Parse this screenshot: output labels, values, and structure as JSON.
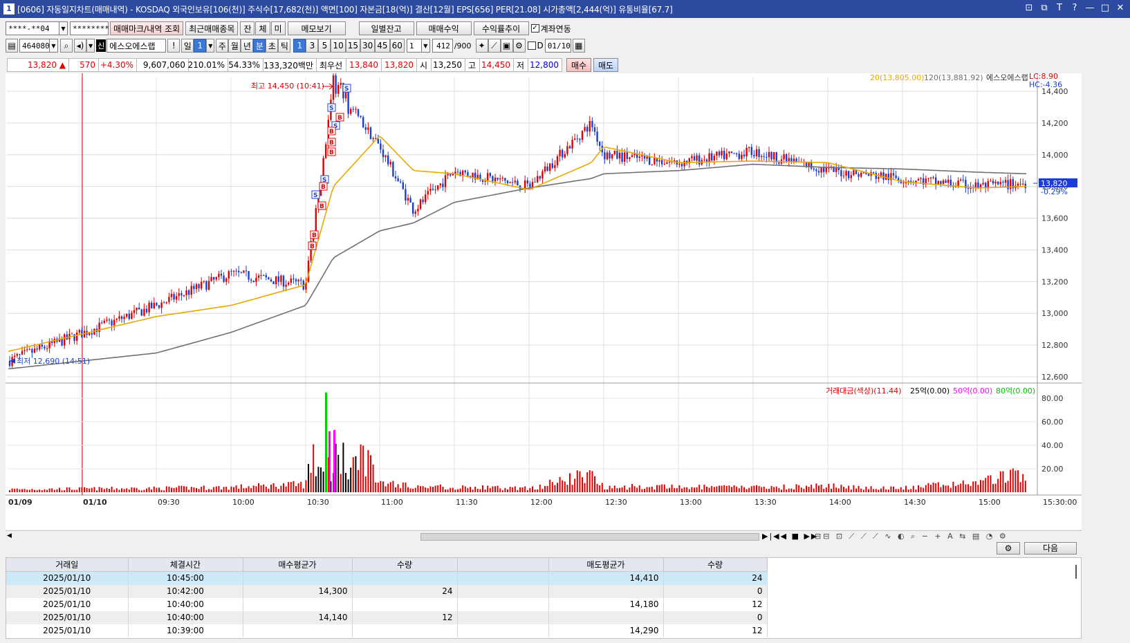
{
  "window": {
    "title": "[0606] 자동일지차트(매매내역) - KOSDAQ 외국인보유[106(천)] 주식수[17,682(천)] 액면[100] 자본금[18(억)] 결산[12월] EPS[656] PER[21.08] 시가총액[2,444(억)] 유통비율[67.7]",
    "icon_label": "1"
  },
  "toolbar1": {
    "account": "****-**04",
    "password": "********",
    "btn_mark": "매매마크/내역 조회",
    "btn_recent": "최근매매종목",
    "btn_jan": "잔",
    "btn_che": "체",
    "btn_mi": "미",
    "btn_memo": "메모보기",
    "btn_daily": "일별잔고",
    "btn_profit": "매매수익",
    "btn_trend": "수익률추이",
    "link_label": "계좌연동"
  },
  "toolbar2": {
    "code": "464080",
    "new_badge": "신",
    "name": "에스오에스랩",
    "excl": "!",
    "periods": [
      "일",
      "1",
      "주",
      "월",
      "년",
      "분",
      "초",
      "틱"
    ],
    "intervals": [
      "1",
      "3",
      "5",
      "10",
      "15",
      "30",
      "45",
      "60"
    ],
    "count": "1",
    "bars": "412",
    "bars_total": "/900",
    "d_label": "D",
    "date": "01/10"
  },
  "quote": {
    "price": "13,820 ▲",
    "change": "570",
    "rate": "+4.30%",
    "volume": "9,607,060",
    "vol_ratio": "210.01%",
    "turnover": "54.33%",
    "amount": "133,320백만",
    "best_label": "최우선",
    "ask": "13,840",
    "bid": "13,820",
    "open_label": "시",
    "open": "13,250",
    "high_label": "고",
    "high": "14,450",
    "low_label": "저",
    "low": "12,800",
    "buy_btn": "매수",
    "sell_btn": "매도"
  },
  "chart": {
    "legend_ma20": "20(13,805.00)",
    "legend_ma120": "120(13,881.92)",
    "legend_name": "에스오에스랩",
    "lc": "LC:8.90",
    "hc": "HC:-4.36",
    "high_marker": "최고 14,450 (10:41)",
    "low_marker": "최저 12,690 (14:51)",
    "current_price": "13,820",
    "current_rate": "-0.29%",
    "price_ticks": [
      "14,400",
      "14,200",
      "14,000",
      "13,800",
      "13,600",
      "13,400",
      "13,200",
      "13,000",
      "12,800",
      "12,600"
    ],
    "vol_legend_main": "거래대금(색상)(11.44)",
    "vol_legend_25": "25억(0.00)",
    "vol_legend_50": "50억(0.00)",
    "vol_legend_80": "80억(0.00)",
    "vol_ticks": [
      "80.00",
      "60.00",
      "40.00",
      "20.00"
    ],
    "time_labels": [
      "01/09",
      "01/10",
      "09:30",
      "10:00",
      "10:30",
      "11:00",
      "11:30",
      "12:00",
      "12:30",
      "13:00",
      "13:30",
      "14:00",
      "14:30",
      "15:00",
      "15:30:00"
    ],
    "colors": {
      "up": "#e00000",
      "down": "#1a3fd0",
      "ma20": "#e8a800",
      "ma120": "#707070",
      "vol25": "#000000",
      "vol50": "#ff00ff",
      "vol80": "#00d000"
    }
  },
  "chart_data": {
    "type": "candlestick",
    "title": "",
    "ylabel": "",
    "ylim": [
      12600,
      14450
    ],
    "x": [
      "09:00",
      "09:30",
      "10:00",
      "10:30",
      "10:41",
      "11:00",
      "11:10",
      "11:30",
      "12:00",
      "12:25",
      "12:30",
      "13:00",
      "13:30",
      "14:00",
      "14:30",
      "15:00",
      "15:20"
    ],
    "series": [
      {
        "name": "20",
        "values": [
          12760,
          12980,
          13050,
          13180,
          13800,
          14120,
          13900,
          13880,
          13780,
          13950,
          14050,
          13950,
          13960,
          13950,
          13830,
          13790,
          13800
        ]
      },
      {
        "name": "120",
        "values": [
          12650,
          12750,
          12880,
          13050,
          13350,
          13520,
          13570,
          13700,
          13790,
          13850,
          13880,
          13900,
          13940,
          13920,
          13910,
          13890,
          13880
        ]
      }
    ],
    "price_path": [
      12700,
      13050,
      13250,
      13180,
      14450,
      14050,
      13650,
      13900,
      13800,
      14200,
      14000,
      13950,
      14020,
      13900,
      13850,
      13800,
      13820
    ],
    "volume_amount_eok": [
      3,
      4,
      5,
      8,
      85,
      10,
      6,
      5,
      4,
      18,
      6,
      5,
      5,
      6,
      4,
      10,
      20
    ]
  },
  "trades": {
    "headers": [
      "거래일",
      "체결시간",
      "매수평균가",
      "수량",
      "",
      "매도평균가",
      "수량"
    ],
    "rows": [
      [
        "2025/01/10",
        "10:45:00",
        "",
        "",
        "",
        "14,410",
        "24"
      ],
      [
        "2025/01/10",
        "10:42:00",
        "14,300",
        "24",
        "",
        "",
        "0"
      ],
      [
        "2025/01/10",
        "10:40:00",
        "",
        "",
        "",
        "14,180",
        "12"
      ],
      [
        "2025/01/10",
        "10:40:00",
        "14,140",
        "12",
        "",
        "",
        "0"
      ],
      [
        "2025/01/10",
        "10:39:00",
        "",
        "",
        "",
        "14,290",
        "12"
      ]
    ],
    "next_btn": "다음"
  }
}
